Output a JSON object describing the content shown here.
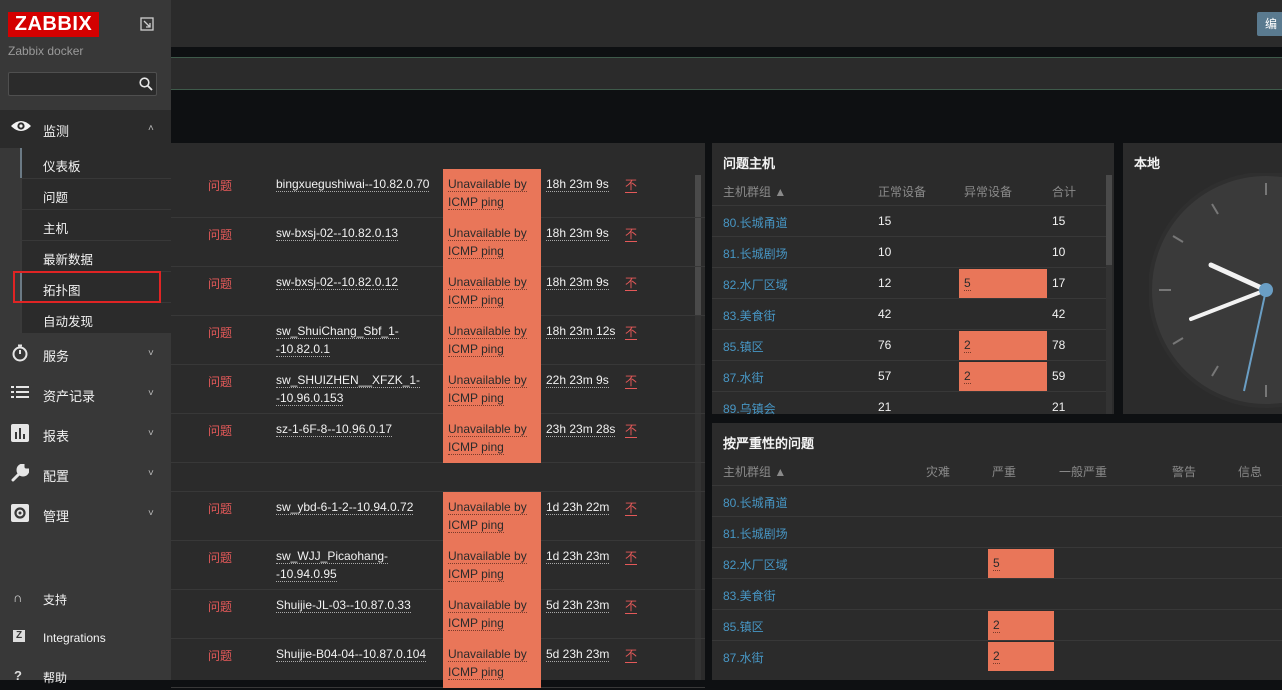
{
  "app": {
    "logo": "ZABBIX",
    "server_name": "Zabbix docker",
    "search_placeholder": ""
  },
  "sidebar": {
    "monitoring": {
      "label": "监测",
      "icon": "eye-icon"
    },
    "monitoring_items": [
      {
        "label": "仪表板"
      },
      {
        "label": "问题"
      },
      {
        "label": "主机"
      },
      {
        "label": "最新数据"
      },
      {
        "label": "拓扑图"
      },
      {
        "label": "自动发现"
      }
    ],
    "sections": [
      {
        "label": "服务",
        "icon": "stopwatch-icon"
      },
      {
        "label": "资产记录",
        "icon": "list-icon"
      },
      {
        "label": "报表",
        "icon": "bar-chart-icon"
      },
      {
        "label": "配置",
        "icon": "wrench-icon"
      },
      {
        "label": "管理",
        "icon": "gear-icon"
      }
    ],
    "bottom": [
      {
        "label": "支持",
        "icon": "headset-icon"
      },
      {
        "label": "Integrations",
        "icon": "zabbix-z-icon"
      },
      {
        "label": "帮助",
        "icon": "question-icon"
      }
    ]
  },
  "topbar": {
    "edit_label": "编"
  },
  "problems": {
    "rows": [
      {
        "status": "问题",
        "host": "bingxuegushiwai--10.82.0.70",
        "problem1": "Unavailable by",
        "problem2": "ICMP ping",
        "duration": "18h 23m 9s",
        "ack": "不"
      },
      {
        "status": "问题",
        "host": "sw-bxsj-02--10.82.0.13",
        "problem1": "Unavailable by",
        "problem2": "ICMP ping",
        "duration": "18h 23m 9s",
        "ack": "不"
      },
      {
        "status": "问题",
        "host": "sw-bxsj-02--10.82.0.12",
        "problem1": "Unavailable by",
        "problem2": "ICMP ping",
        "duration": "18h 23m 9s",
        "ack": "不"
      },
      {
        "status": "问题",
        "host": "sw_ShuiChang_Sbf_1-",
        "host2": "-10.82.0.1",
        "problem1": "Unavailable by",
        "problem2": "ICMP ping",
        "duration": "18h 23m 12s",
        "ack": "不"
      },
      {
        "status": "问题",
        "host": "sw_SHUIZHEN__XFZK_1-",
        "host2": "-10.96.0.153",
        "problem1": "Unavailable by",
        "problem2": "ICMP ping",
        "duration": "22h 23m 9s",
        "ack": "不"
      },
      {
        "status": "问题",
        "host": "sz-1-6F-8--10.96.0.17",
        "problem1": "Unavailable by",
        "problem2": "ICMP ping",
        "duration": "23h 23m 28s",
        "ack": "不"
      },
      {
        "status": "问题",
        "host": "sw_ybd-6-1-2--10.94.0.72",
        "problem1": "Unavailable by",
        "problem2": "ICMP ping",
        "duration": "1d 23h 22m",
        "ack": "不"
      },
      {
        "status": "问题",
        "host": "sw_WJJ_Picaohang-",
        "host2": "-10.94.0.95",
        "problem1": "Unavailable by",
        "problem2": "ICMP ping",
        "duration": "1d 23h 23m",
        "ack": "不"
      },
      {
        "status": "问题",
        "host": "Shuijie-JL-03--10.87.0.33",
        "problem1": "Unavailable by",
        "problem2": "ICMP ping",
        "duration": "5d 23h 23m",
        "ack": "不"
      },
      {
        "status": "问题",
        "host": "Shuijie-B04-04--10.87.0.104",
        "problem1": "Unavailable by",
        "problem2": "ICMP ping",
        "duration": "5d 23h 23m",
        "ack": "不"
      }
    ]
  },
  "problem_hosts": {
    "title": "问题主机",
    "headers": {
      "group": "主机群组 ▲",
      "ok": "正常设备",
      "problem": "异常设备",
      "total": "合计"
    },
    "rows": [
      {
        "group": "80.长城甬道",
        "ok": "15",
        "problem": "",
        "total": "15"
      },
      {
        "group": "81.长城剧场",
        "ok": "10",
        "problem": "",
        "total": "10"
      },
      {
        "group": "82.水厂区域",
        "ok": "12",
        "problem": "5",
        "total": "17"
      },
      {
        "group": "83.美食街",
        "ok": "42",
        "problem": "",
        "total": "42"
      },
      {
        "group": "85.镇区",
        "ok": "76",
        "problem": "2",
        "total": "78"
      },
      {
        "group": "87.水街",
        "ok": "57",
        "problem": "2",
        "total": "59"
      },
      {
        "group": "89.乌镇会",
        "ok": "21",
        "problem": "",
        "total": "21"
      }
    ]
  },
  "clock": {
    "title": "本地"
  },
  "severity": {
    "title": "按严重性的问题",
    "headers": {
      "group": "主机群组 ▲",
      "disaster": "灾难",
      "high": "严重",
      "average": "一般严重",
      "warning": "警告",
      "info": "信息"
    },
    "rows": [
      {
        "group": "80.长城甬道",
        "high": ""
      },
      {
        "group": "81.长城剧场",
        "high": ""
      },
      {
        "group": "82.水厂区域",
        "high": "5"
      },
      {
        "group": "83.美食街",
        "high": ""
      },
      {
        "group": "85.镇区",
        "high": "2"
      },
      {
        "group": "87.水街",
        "high": "2"
      }
    ]
  },
  "colors": {
    "problem_cell": "#e97659",
    "problem_text": "#e45959",
    "link": "#4796c4",
    "logo": "#d40000"
  }
}
